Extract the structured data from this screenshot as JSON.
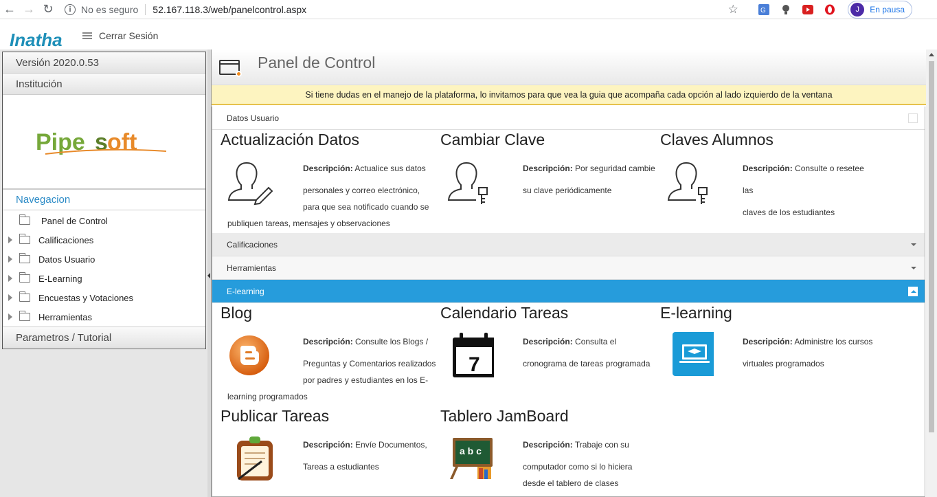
{
  "browser": {
    "security": "No es seguro",
    "url": "52.167.118.3/web/panelcontrol.aspx",
    "profile_initial": "J",
    "profile_status": "En pausa"
  },
  "header": {
    "logo_text": "Inatha",
    "logout": "Cerrar Sesión"
  },
  "sidebar": {
    "version": "Versión 2020.0.53",
    "institution": "Institución",
    "brand_logo": "Pipesoft",
    "navigation": "Navegacion",
    "tree": [
      {
        "label": "Panel de Control"
      },
      {
        "label": "Calificaciones"
      },
      {
        "label": "Datos Usuario"
      },
      {
        "label": "E-Learning"
      },
      {
        "label": "Encuestas y Votaciones"
      },
      {
        "label": "Herramientas"
      }
    ],
    "params": "Parametros / Tutorial"
  },
  "main": {
    "title": "Panel de Control",
    "notice": "Si tiene dudas en el manejo de la plataforma, lo invitamos para que vea la guia que acompaña cada opción al lado izquierdo de la ventana",
    "desc_label": "Descripción:",
    "sections": {
      "datos_usuario": "Datos Usuario",
      "calificaciones": "Calificaciones",
      "herramientas": "Herramientas",
      "elearning": "E-learning"
    },
    "datos_cards": [
      {
        "title": "Actualización Datos",
        "desc_1": "Actualice sus datos",
        "desc_2": "personales y correo electrónico,",
        "desc_3": "para que sea notificado cuando se",
        "desc_4": "publiquen tareas, mensajes y observaciones"
      },
      {
        "title": "Cambiar Clave",
        "desc_1": "Por seguridad cambie",
        "desc_2": "su clave periódicamente"
      },
      {
        "title": "Claves Alumnos",
        "desc_1": "Consulte o resetee las",
        "desc_2": "claves de los estudiantes"
      }
    ],
    "elearning_cards": [
      {
        "title": "Blog",
        "desc_1": "Consulte los Blogs /",
        "desc_2": "Preguntas y Comentarios realizados",
        "desc_3": "por padres y estudiantes en los E-",
        "desc_4": "learning programados"
      },
      {
        "title": "Calendario Tareas",
        "desc_1": "Consulta el",
        "desc_2": "cronograma de tareas programada",
        "icon_number": "7"
      },
      {
        "title": "E-learning",
        "desc_1": "Administre los cursos",
        "desc_2": "virtuales programados"
      },
      {
        "title": "Publicar Tareas",
        "desc_1": "Envíe Documentos,",
        "desc_2": "Tareas a estudiantes"
      },
      {
        "title": "Tablero JamBoard",
        "desc_1": "Trabaje con su",
        "desc_2": "computador como si lo hiciera",
        "desc_3": "desde el tablero de clases",
        "icon_letters": "a b c"
      }
    ]
  }
}
